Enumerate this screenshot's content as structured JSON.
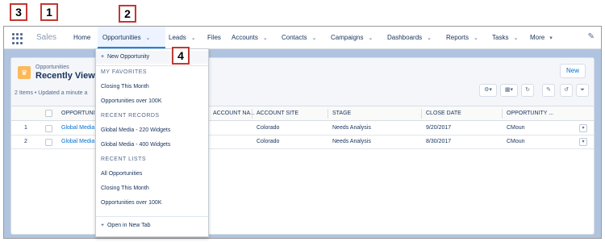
{
  "app": {
    "name": "Sales"
  },
  "nav": {
    "items": [
      {
        "label": "Home",
        "has_menu": false
      },
      {
        "label": "Opportunities",
        "has_menu": true
      },
      {
        "label": "Leads",
        "has_menu": true
      },
      {
        "label": "Files",
        "has_menu": false
      },
      {
        "label": "Accounts",
        "has_menu": true
      },
      {
        "label": "Contacts",
        "has_menu": true
      },
      {
        "label": "Campaigns",
        "has_menu": true
      },
      {
        "label": "Dashboards",
        "has_menu": true
      },
      {
        "label": "Reports",
        "has_menu": true
      },
      {
        "label": "Tasks",
        "has_menu": true
      },
      {
        "label": "More",
        "has_menu": true
      }
    ],
    "chevron": "⌄",
    "more_caret": "▾"
  },
  "list": {
    "object_label": "Opportunities",
    "title": "Recently Viewed",
    "meta": "2 Items • Updated a minute a",
    "new_button": "New",
    "columns": [
      "Opportunity ...",
      "Account Na...",
      "Account Site",
      "Stage",
      "Close Date",
      "Opportunity ..."
    ],
    "rows": [
      {
        "num": "1",
        "name": "Global Media",
        "site": "Colorado",
        "stage": "Needs Analysis",
        "close_date": "9/20/2017",
        "owner": "CMoun"
      },
      {
        "num": "2",
        "name": "Global Media",
        "site": "Colorado",
        "stage": "Needs Analysis",
        "close_date": "8/30/2017",
        "owner": "CMoun"
      }
    ]
  },
  "dropdown": {
    "new_item": "New Opportunity",
    "favorites_header": "MY FAVORITES",
    "favorites": [
      "Closing This Month",
      "Opportunities over 100K"
    ],
    "recent_records_header": "RECENT RECORDS",
    "recent_records": [
      "Global Media - 220 Widgets",
      "Global Media - 400 Widgets"
    ],
    "recent_lists_header": "RECENT LISTS",
    "recent_lists": [
      "All Opportunities",
      "Closing This Month",
      "Opportunities over 100K"
    ],
    "open_new_tab": "Open in New Tab"
  },
  "callouts": [
    "1",
    "2",
    "3",
    "4"
  ],
  "colors": {
    "accent": "#1589ee",
    "link": "#0070d2",
    "callout_border": "#c23934",
    "object_icon": "#fcb95b"
  }
}
